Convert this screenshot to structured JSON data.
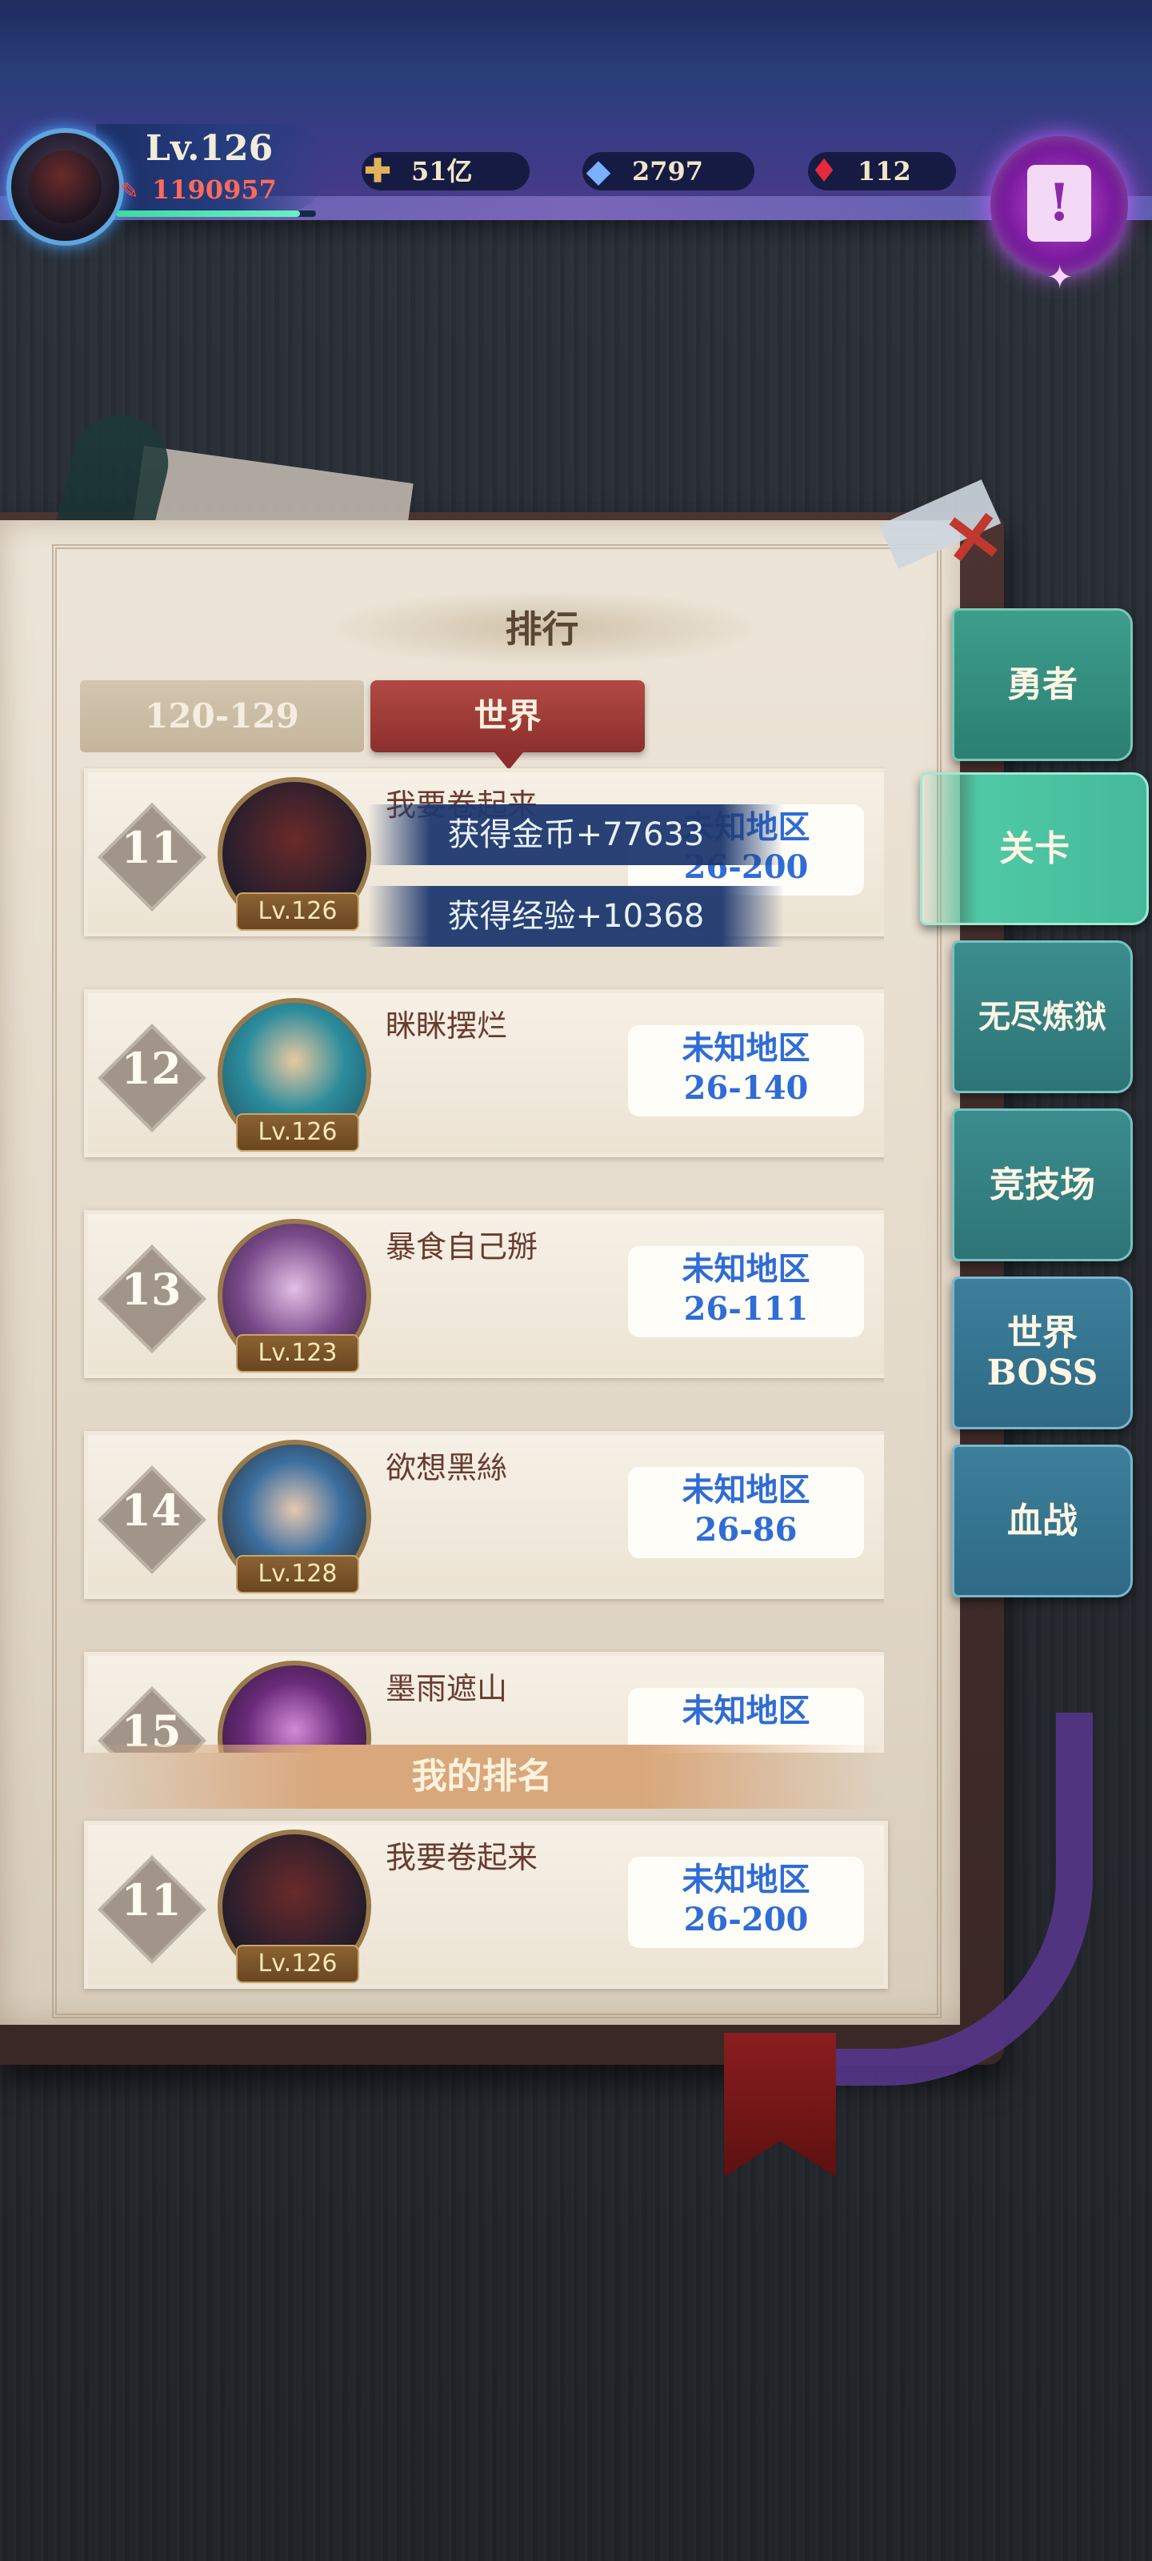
{
  "player": {
    "level": "Lv.126",
    "power": "1190957"
  },
  "resources": [
    {
      "icon": "gold-scroll-icon",
      "value": "51亿"
    },
    {
      "icon": "diamond-icon",
      "value": "2797"
    },
    {
      "icon": "red-crystal-icon",
      "value": "112"
    }
  ],
  "panel": {
    "title": "排行",
    "tabs": {
      "range": "120-129",
      "world": "世界"
    },
    "my_rank_label": "我的排名"
  },
  "toasts": {
    "gold": "获得金币+77633",
    "exp": "获得经验+10368"
  },
  "rankings": [
    {
      "rank": "11",
      "name": "我要卷起来",
      "level": "Lv.126",
      "server_line1": "未知地区",
      "server_line2": "26-200"
    },
    {
      "rank": "12",
      "name": "眯眯摆烂",
      "level": "Lv.126",
      "server_line1": "未知地区",
      "server_line2": "26-140"
    },
    {
      "rank": "13",
      "name": "暴食自己掰",
      "level": "Lv.123",
      "server_line1": "未知地区",
      "server_line2": "26-111"
    },
    {
      "rank": "14",
      "name": "欲想黑絲",
      "level": "Lv.128",
      "server_line1": "未知地区",
      "server_line2": "26-86"
    },
    {
      "rank": "15",
      "name": "墨雨遮山",
      "level": "",
      "server_line1": "未知地区",
      "server_line2": ""
    }
  ],
  "my_rank": {
    "rank": "11",
    "name": "我要卷起来",
    "level": "Lv.126",
    "server_line1": "未知地区",
    "server_line2": "26-200"
  },
  "side_tabs": [
    {
      "label": "勇者"
    },
    {
      "label": "关卡"
    },
    {
      "label": "无尽炼狱"
    },
    {
      "label": "竞技场"
    },
    {
      "label_line1": "世界",
      "label_line2": "BOSS"
    },
    {
      "label": "血战"
    }
  ]
}
